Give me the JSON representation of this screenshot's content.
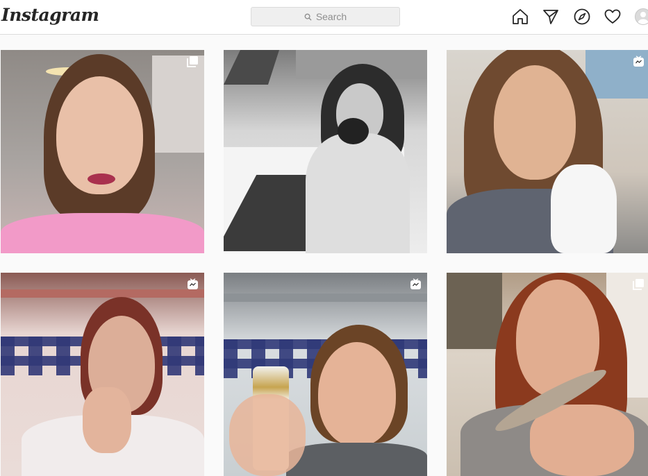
{
  "app": {
    "logo": "Instagram"
  },
  "search": {
    "placeholder": "Search"
  },
  "nav": {
    "icons": [
      "home-icon",
      "direct-icon",
      "explore-icon",
      "activity-icon",
      "profile-avatar"
    ]
  },
  "colors": {
    "border": "#dbdbdb",
    "text": "#262626",
    "muted": "#8e8e8e",
    "background": "#fafafa"
  },
  "grid": {
    "posts": [
      {
        "type_icon": "carousel-icon"
      },
      {
        "type_icon": ""
      },
      {
        "type_icon": "igtv-icon"
      },
      {
        "type_icon": "igtv-icon"
      },
      {
        "type_icon": "igtv-icon"
      },
      {
        "type_icon": "carousel-icon"
      }
    ]
  }
}
